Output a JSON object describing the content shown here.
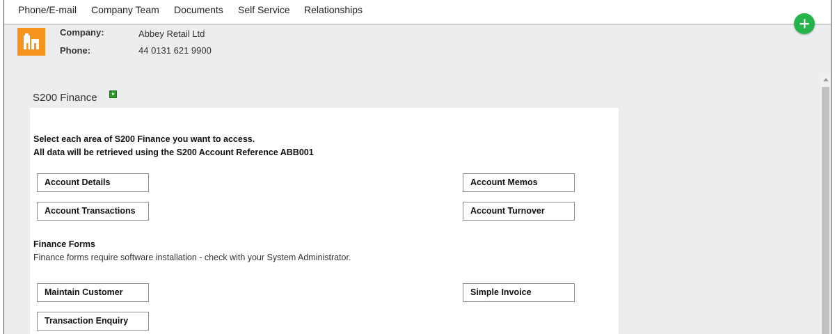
{
  "nav": {
    "tabs": [
      "Phone/E-mail",
      "Company Team",
      "Documents",
      "Self Service",
      "Relationships"
    ]
  },
  "add_button": {
    "symbol": "+",
    "color": "#27b34b"
  },
  "header": {
    "company_label": "Company:",
    "company_value": "Abbey Retail Ltd",
    "phone_label": "Phone:",
    "phone_value": "44 0131 621 9900",
    "logo_icon": "building-icon",
    "logo_color": "#f7941d"
  },
  "section": {
    "title": "S200 Finance",
    "go_icon": "play-icon"
  },
  "panel": {
    "intro_line1": "Select each area of S200 Finance you want to access.",
    "intro_line2": "All data will be retrieved using the S200 Account Reference ABB001",
    "buttons": {
      "account_details": "Account Details",
      "account_memos": "Account Memos",
      "account_transactions": "Account Transactions",
      "account_turnover": "Account Turnover"
    },
    "forms_title": "Finance Forms",
    "forms_note": "Finance forms require software installation - check with your System Administrator.",
    "form_buttons": {
      "maintain_customer": "Maintain Customer",
      "simple_invoice": "Simple Invoice",
      "transaction_enquiry": "Transaction Enquiry"
    }
  }
}
